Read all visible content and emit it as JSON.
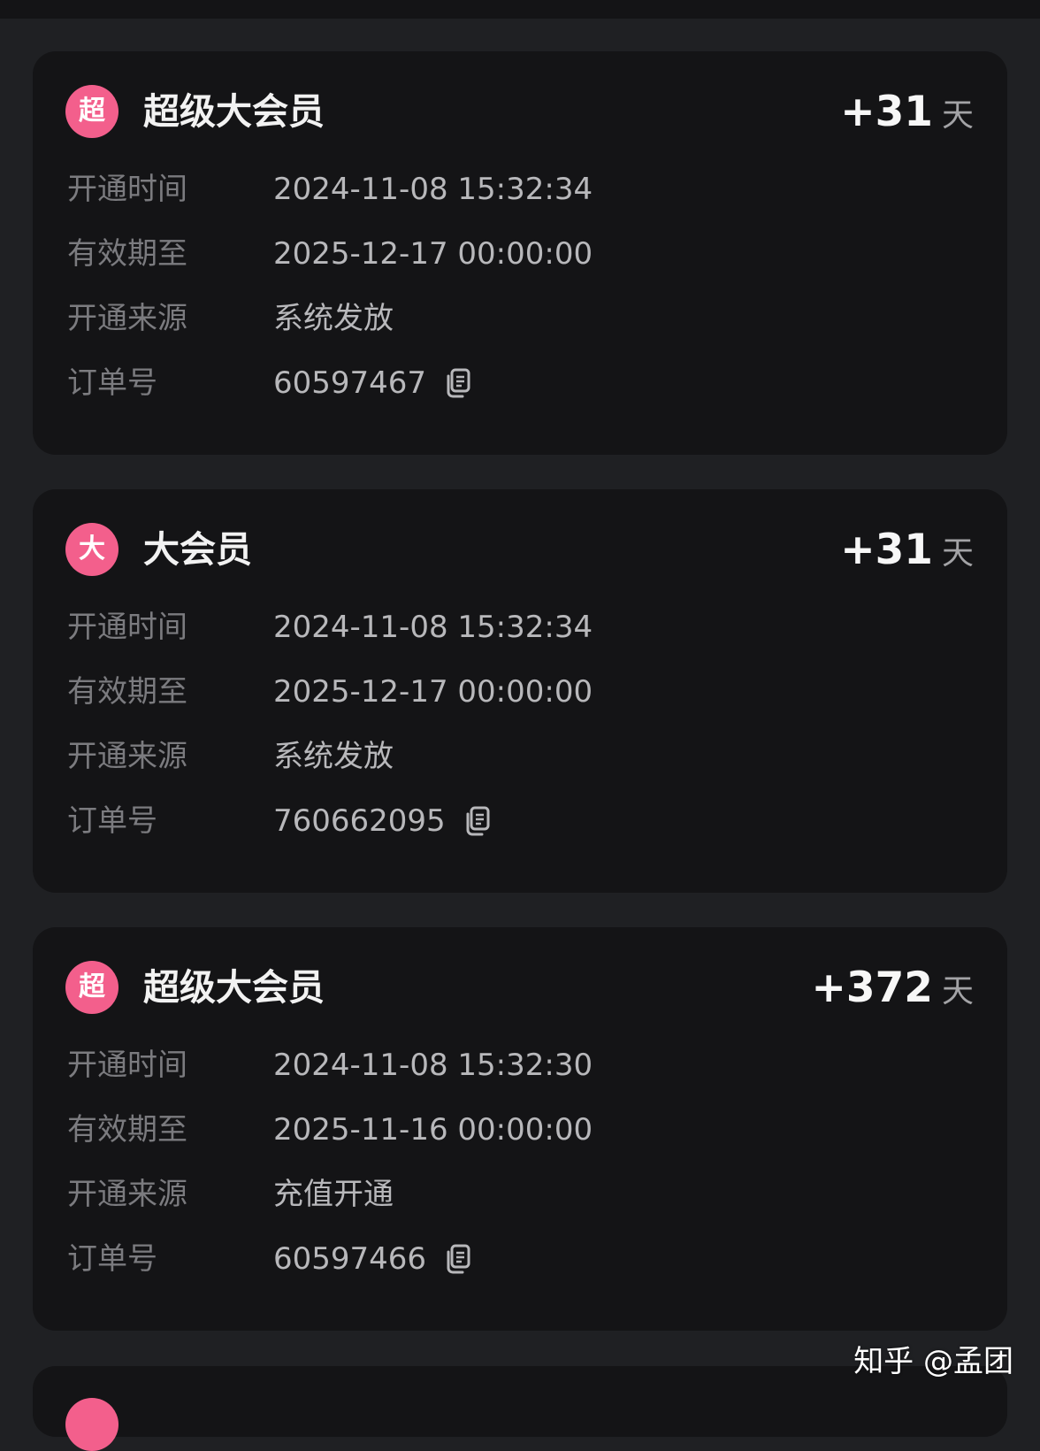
{
  "cards": [
    {
      "badge_char": "超",
      "title": "超级大会员",
      "days": "+31",
      "days_unit": "天",
      "rows": [
        {
          "label": "开通时间",
          "value": "2024-11-08 15:32:34"
        },
        {
          "label": "有效期至",
          "value": "2025-12-17 00:00:00"
        },
        {
          "label": "开通来源",
          "value": "系统发放"
        },
        {
          "label": "订单号",
          "value": "60597467",
          "icon": "copy-icon"
        }
      ]
    },
    {
      "badge_char": "大",
      "title": "大会员",
      "days": "+31",
      "days_unit": "天",
      "rows": [
        {
          "label": "开通时间",
          "value": "2024-11-08 15:32:34"
        },
        {
          "label": "有效期至",
          "value": "2025-12-17 00:00:00"
        },
        {
          "label": "开通来源",
          "value": "系统发放"
        },
        {
          "label": "订单号",
          "value": "760662095",
          "icon": "copy-icon"
        }
      ]
    },
    {
      "badge_char": "超",
      "title": "超级大会员",
      "days": "+372",
      "days_unit": "天",
      "rows": [
        {
          "label": "开通时间",
          "value": "2024-11-08 15:32:30"
        },
        {
          "label": "有效期至",
          "value": "2025-11-16 00:00:00"
        },
        {
          "label": "开通来源",
          "value": "充值开通"
        },
        {
          "label": "订单号",
          "value": "60597466",
          "icon": "copy-icon"
        }
      ]
    }
  ],
  "watermark": "知乎 @孟团",
  "colors": {
    "background": "#1f2023",
    "card": "#141416",
    "badge": "#f35f8c"
  }
}
